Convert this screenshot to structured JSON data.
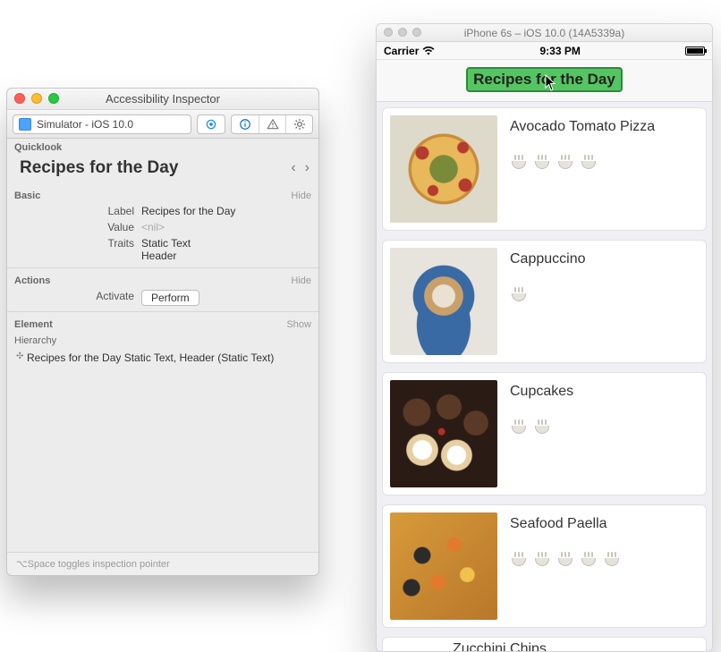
{
  "inspector": {
    "title": "Accessibility Inspector",
    "target": "Simulator - iOS 10.0",
    "quicklook_header": "Quicklook",
    "quicklook_value": "Recipes for the Day",
    "basic_header": "Basic",
    "hide_label": "Hide",
    "show_label": "Show",
    "label_key": "Label",
    "label_value": "Recipes for the Day",
    "value_key": "Value",
    "value_value": "<nil>",
    "traits_key": "Traits",
    "traits_value_1": "Static Text",
    "traits_value_2": "Header",
    "actions_header": "Actions",
    "activate_key": "Activate",
    "perform_label": "Perform",
    "element_header": "Element",
    "hierarchy_header": "Hierarchy",
    "hierarchy_value": "Recipes for the Day Static Text, Header (Static Text)",
    "footer": "⌥Space toggles inspection pointer"
  },
  "simulator": {
    "window_title": "iPhone 6s – iOS 10.0 (14A5339a)",
    "carrier": "Carrier",
    "time": "9:33 PM",
    "page_title": "Recipes for the Day",
    "recipes": [
      {
        "name": "Avocado Tomato Pizza",
        "rating": 4,
        "img": "pizza"
      },
      {
        "name": "Cappuccino",
        "rating": 1,
        "img": "cappuccino"
      },
      {
        "name": "Cupcakes",
        "rating": 2,
        "img": "cupcakes"
      },
      {
        "name": "Seafood Paella",
        "rating": 5,
        "img": "paella"
      },
      {
        "name": "Zucchini Chips",
        "rating": 0,
        "img": ""
      }
    ]
  }
}
